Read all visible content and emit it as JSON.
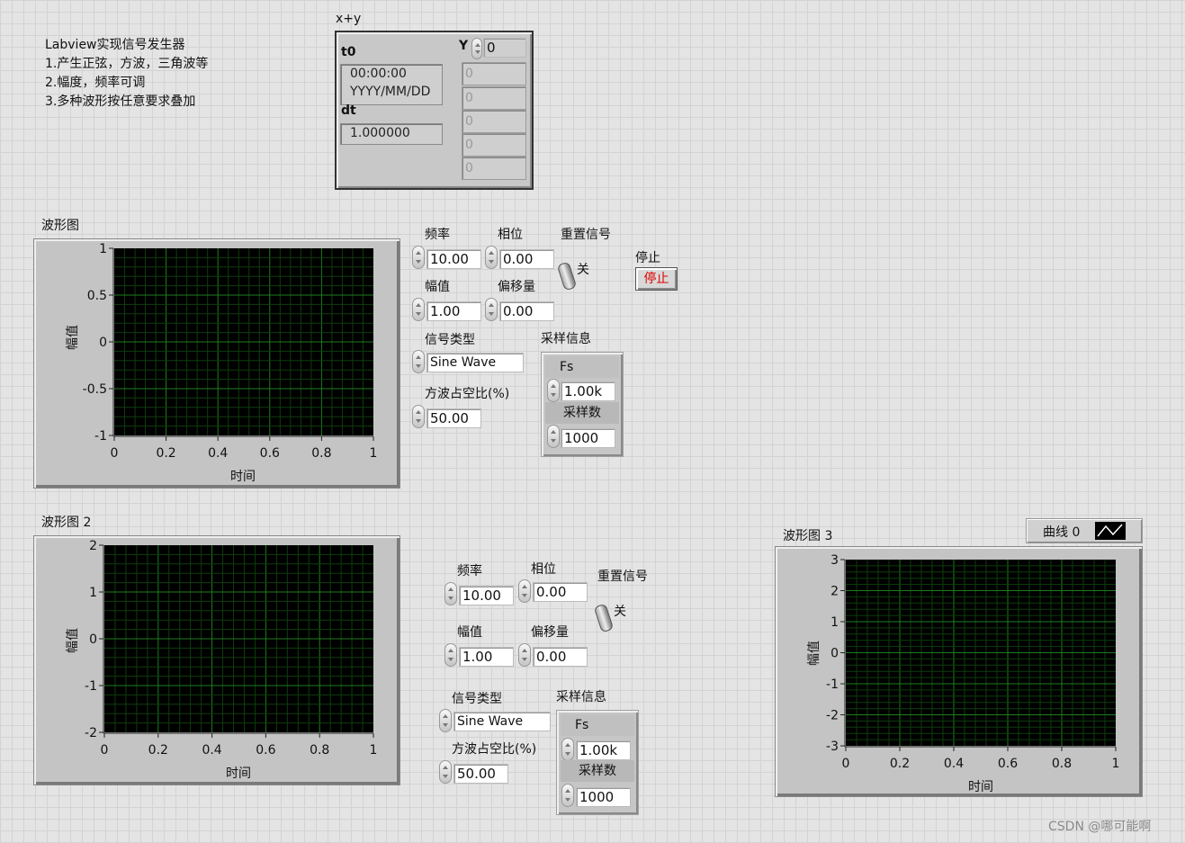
{
  "notes": [
    "Labview实现信号发生器",
    "1.产生正弦，方波，三角波等",
    "2.幅度，频率可调",
    "3.多种波形按任意要求叠加"
  ],
  "xy_cluster": {
    "title": "x+y",
    "t0_label": "t0",
    "t0_time": "00:00:00",
    "t0_date": "YYYY/MM/DD",
    "dt_label": "dt",
    "dt_value": "1.000000",
    "y_label": "Y",
    "y_index": "0",
    "y_values": [
      "0",
      "0",
      "0",
      "0",
      "0"
    ]
  },
  "graph1": {
    "title": "波形图",
    "ylabel": "幅值",
    "xlabel": "时间"
  },
  "graph2": {
    "title": "波形图 2",
    "ylabel": "幅值",
    "xlabel": "时间"
  },
  "graph3": {
    "title": "波形图 3",
    "ylabel": "幅值",
    "xlabel": "时间",
    "legend": "曲线 0"
  },
  "controls1": {
    "freq_label": "频率",
    "freq": "10.00",
    "phase_label": "相位",
    "phase": "0.00",
    "reset_label": "重置信号",
    "reset_state": "关",
    "amp_label": "幅值",
    "amp": "1.00",
    "offset_label": "偏移量",
    "offset": "0.00",
    "type_label": "信号类型",
    "type": "Sine Wave",
    "duty_label": "方波占空比(%)",
    "duty": "50.00",
    "sampling_label": "采样信息",
    "fs_label": "Fs",
    "fs": "1.00k",
    "samples_label": "采样数",
    "samples": "1000"
  },
  "controls2": {
    "freq_label": "频率",
    "freq": "10.00",
    "phase_label": "相位",
    "phase": "0.00",
    "reset_label": "重置信号",
    "reset_state": "关",
    "amp_label": "幅值",
    "amp": "1.00",
    "offset_label": "偏移量",
    "offset": "0.00",
    "type_label": "信号类型",
    "type": "Sine Wave",
    "duty_label": "方波占空比(%)",
    "duty": "50.00",
    "sampling_label": "采样信息",
    "fs_label": "Fs",
    "fs": "1.00k",
    "samples_label": "采样数",
    "samples": "1000"
  },
  "stop": {
    "label": "停止",
    "button": "停止"
  },
  "watermark": "CSDN @哪可能啊",
  "chart_data": [
    {
      "type": "line",
      "title": "波形图",
      "xlabel": "时间",
      "ylabel": "幅值",
      "xlim": [
        0,
        1
      ],
      "ylim": [
        -1,
        1
      ],
      "xticks": [
        "0",
        "0.2",
        "0.4",
        "0.6",
        "0.8",
        "1"
      ],
      "yticks": [
        "1",
        "0.5",
        "0",
        "-0.5",
        "-1"
      ],
      "series": [],
      "grid": true,
      "background": "#000000",
      "grid_color": "#1e7d1e"
    },
    {
      "type": "line",
      "title": "波形图 2",
      "xlabel": "时间",
      "ylabel": "幅值",
      "xlim": [
        0,
        1
      ],
      "ylim": [
        -2,
        2
      ],
      "xticks": [
        "0",
        "0.2",
        "0.4",
        "0.6",
        "0.8",
        "1"
      ],
      "yticks": [
        "2",
        "1",
        "0",
        "-1",
        "-2"
      ],
      "series": [],
      "grid": true,
      "background": "#000000",
      "grid_color": "#1e7d1e"
    },
    {
      "type": "line",
      "title": "波形图 3",
      "xlabel": "时间",
      "ylabel": "幅值",
      "xlim": [
        0,
        1
      ],
      "ylim": [
        -3,
        3
      ],
      "xticks": [
        "0",
        "0.2",
        "0.4",
        "0.6",
        "0.8",
        "1"
      ],
      "yticks": [
        "3",
        "2",
        "1",
        "0",
        "-1",
        "-2",
        "-3"
      ],
      "series": [],
      "legend": [
        "曲线 0"
      ],
      "grid": true,
      "background": "#000000",
      "grid_color": "#1e7d1e"
    }
  ]
}
